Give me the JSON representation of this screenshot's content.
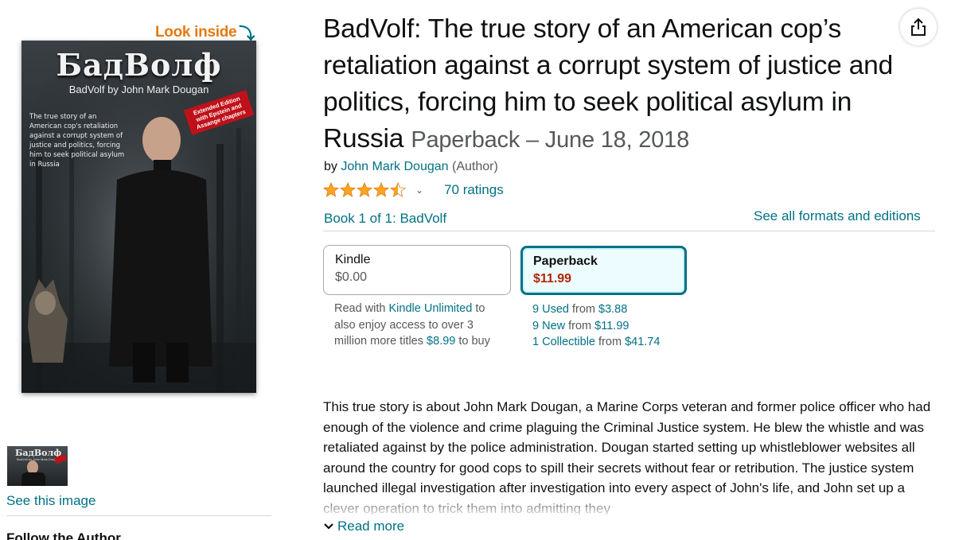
{
  "product": {
    "look_inside": "Look inside",
    "title": "BadVolf: The true story of an American cop’s retaliation against a corrupt system of justice and politics, forcing him to seek political asylum in Russia",
    "format_date": "Paperback – June 18, 2018",
    "by_prefix": "by",
    "author": "John Mark Dougan",
    "author_role": "(Author)",
    "rating_value": 4.5,
    "ratings_count": "70 ratings",
    "series": "Book 1 of 1: BadVolf",
    "see_all_formats": "See all formats and editions"
  },
  "cover": {
    "title": "БадВолф",
    "subtitle": "BadVolf by John Mark Dougan",
    "blurb": "The true story of an American cop's retaliation against a corrupt system of justice and politics, forcing him to seek political asylum in Russia",
    "badge": "Extended Edition with Epstein and Assange chapters"
  },
  "thumbnail": {
    "title": "БадВолф",
    "subtitle": "BadVolf by John Mark Dougan"
  },
  "left": {
    "see_image": "See this image",
    "follow_author": "Follow the Author"
  },
  "formats": [
    {
      "name": "Kindle",
      "price": "$0.00",
      "selected": false
    },
    {
      "name": "Paperback",
      "price": "$11.99",
      "selected": true
    }
  ],
  "kindle_note": {
    "prefix": "Read with",
    "link": "Kindle Unlimited",
    "middle": "to also enjoy access to over 3 million more titles",
    "price": "$8.99",
    "suffix": "to buy"
  },
  "offers": [
    {
      "label": "9 Used",
      "from": "from",
      "price": "$3.88"
    },
    {
      "label": "9 New",
      "from": "from",
      "price": "$11.99"
    },
    {
      "label": "1 Collectible",
      "from": "from",
      "price": "$41.74"
    }
  ],
  "description": "This true story is about John Mark Dougan, a Marine Corps veteran and former police officer who had enough of the violence and crime plaguing the Criminal Justice system. He blew the whistle and was retaliated against by the police administration. Dougan started setting up whistleblower websites all around the country for good cops to spill their secrets without fear or retribution. The justice system launched illegal investigation after investigation into every aspect of John's life, and John set up a clever operation to trick them into admitting they",
  "read_more": "Read more",
  "colors": {
    "link": "#007185",
    "price": "#b12704",
    "look_inside": "#e47911",
    "star": "#ffa41c",
    "selected_border": "#007185"
  }
}
